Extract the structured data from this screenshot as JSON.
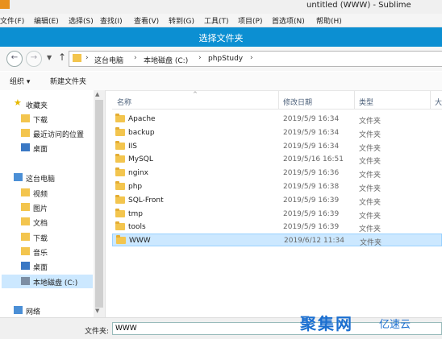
{
  "window": {
    "title": "untitled (WWW) - Sublime"
  },
  "menu": [
    "文件(F)",
    "编辑(E)",
    "选择(S)",
    "查找(I)",
    "查看(V)",
    "转到(G)",
    "工具(T)",
    "项目(P)",
    "首选项(N)",
    "帮助(H)"
  ],
  "dialog": {
    "title": "选择文件夹"
  },
  "breadcrumb": [
    "这台电脑",
    "本地磁盘 (C:)",
    "phpStudy"
  ],
  "toolbar": {
    "organize": "组织 ▾",
    "new_folder": "新建文件夹"
  },
  "nav": {
    "favorites": "收藏夹",
    "fav_items": [
      "下载",
      "最近访问的位置",
      "桌面"
    ],
    "this_pc": "这台电脑",
    "pc_items": [
      "视频",
      "图片",
      "文档",
      "下载",
      "音乐",
      "桌面",
      "本地磁盘 (C:)"
    ],
    "network": "网络"
  },
  "columns": {
    "name": "名称",
    "date": "修改日期",
    "type": "类型",
    "size": "大"
  },
  "files": [
    {
      "name": "Apache",
      "date": "2019/5/9 16:34",
      "type": "文件夹"
    },
    {
      "name": "backup",
      "date": "2019/5/9 16:34",
      "type": "文件夹"
    },
    {
      "name": "IIS",
      "date": "2019/5/9 16:34",
      "type": "文件夹"
    },
    {
      "name": "MySQL",
      "date": "2019/5/16 16:51",
      "type": "文件夹"
    },
    {
      "name": "nginx",
      "date": "2019/5/9 16:36",
      "type": "文件夹"
    },
    {
      "name": "php",
      "date": "2019/5/9 16:38",
      "type": "文件夹"
    },
    {
      "name": "SQL-Front",
      "date": "2019/5/9 16:39",
      "type": "文件夹"
    },
    {
      "name": "tmp",
      "date": "2019/5/9 16:39",
      "type": "文件夹"
    },
    {
      "name": "tools",
      "date": "2019/5/9 16:39",
      "type": "文件夹"
    },
    {
      "name": "WWW",
      "date": "2019/6/12 11:34",
      "type": "文件夹"
    }
  ],
  "filename": {
    "label": "文件夹:",
    "value": "WWW"
  },
  "watermark": {
    "logo": "聚集网",
    "brand": "亿速云"
  },
  "colors": {
    "dialog_title": "#0c8fd2",
    "selection": "#cce8ff",
    "folder": "#f3c54e",
    "watermark": "#1b6fd0"
  }
}
